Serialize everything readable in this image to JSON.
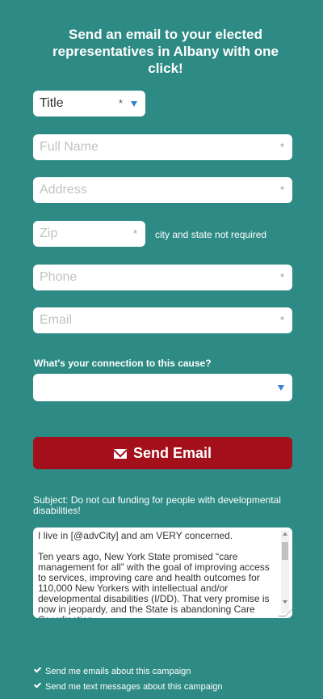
{
  "heading": "Send an email to your elected representatives in Albany with one click!",
  "form": {
    "title_label": "Title",
    "full_name_placeholder": "Full Name",
    "address_placeholder": "Address",
    "zip_placeholder": "Zip",
    "zip_hint": "city and state not required",
    "phone_placeholder": "Phone",
    "email_placeholder": "Email",
    "required_marker": "*",
    "connection_question": "What's your connection to this cause?",
    "connection_selected": ""
  },
  "send_button_label": "Send Email",
  "subject": "Subject: Do not cut funding for people with developmental disabilities!",
  "message": {
    "para1": "I live in [@advCity] and am VERY concerned.",
    "para2": "Ten years ago, New York State promised “care management for all” with the goal of improving access to services, improving care and health outcomes for 110,000 New Yorkers with intellectual and/or developmental disabilities (I/DD). That very promise is now in jeopardy, and the State is abandoning Care Coordination"
  },
  "checkboxes": {
    "emails_label": "Send me emails about this campaign",
    "texts_label": "Send me text messages about this campaign"
  },
  "colors": {
    "background": "#2d8a84",
    "button": "#a3101b",
    "caret": "#3b7fd4"
  }
}
